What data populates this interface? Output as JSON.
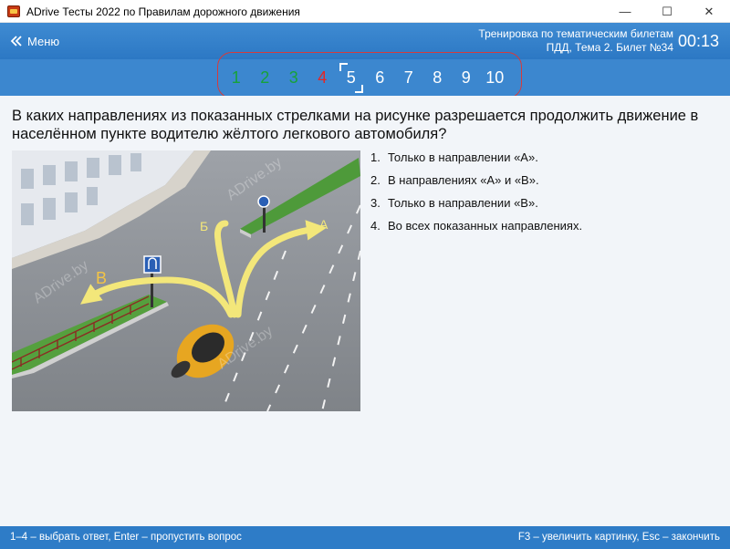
{
  "window": {
    "title": "ADrive Тесты 2022 по Правилам дорожного движения",
    "minimize_glyph": "—",
    "maximize_glyph": "☐",
    "close_glyph": "✕"
  },
  "header": {
    "menu_label": "Меню",
    "mode_line1": "Тренировка по тематическим билетам",
    "mode_line2": "ПДД, Тема 2. Билет №34",
    "timer": "00:13"
  },
  "question_nav": {
    "items": [
      {
        "label": "1",
        "state": "correct"
      },
      {
        "label": "2",
        "state": "correct"
      },
      {
        "label": "3",
        "state": "correct"
      },
      {
        "label": "4",
        "state": "wrong"
      },
      {
        "label": "5",
        "state": "current"
      },
      {
        "label": "6",
        "state": "pending"
      },
      {
        "label": "7",
        "state": "pending"
      },
      {
        "label": "8",
        "state": "pending"
      },
      {
        "label": "9",
        "state": "pending"
      },
      {
        "label": "10",
        "state": "pending"
      }
    ],
    "colors": {
      "correct": "#17a23a",
      "wrong": "#e52525",
      "pending": "#ffffff"
    }
  },
  "question": {
    "text": "В каких направлениях из показанных стрелками на рисунке разрешается продолжить движение в населённом пункте водителю жёлтого легкового автомобиля?"
  },
  "illustration": {
    "labels": {
      "a": "А",
      "b": "Б",
      "v": "В"
    },
    "watermark": "ADrive.by"
  },
  "answers": [
    {
      "num": "1.",
      "text": "Только в направлении «А»."
    },
    {
      "num": "2.",
      "text": "В направлениях «А» и «В»."
    },
    {
      "num": "3.",
      "text": "Только в направлении «В»."
    },
    {
      "num": "4.",
      "text": "Во всех показанных направлениях."
    }
  ],
  "footer": {
    "left": "1–4 – выбрать ответ, Enter – пропустить вопрос",
    "right": "F3 – увеличить картинку, Esc – закончить"
  }
}
